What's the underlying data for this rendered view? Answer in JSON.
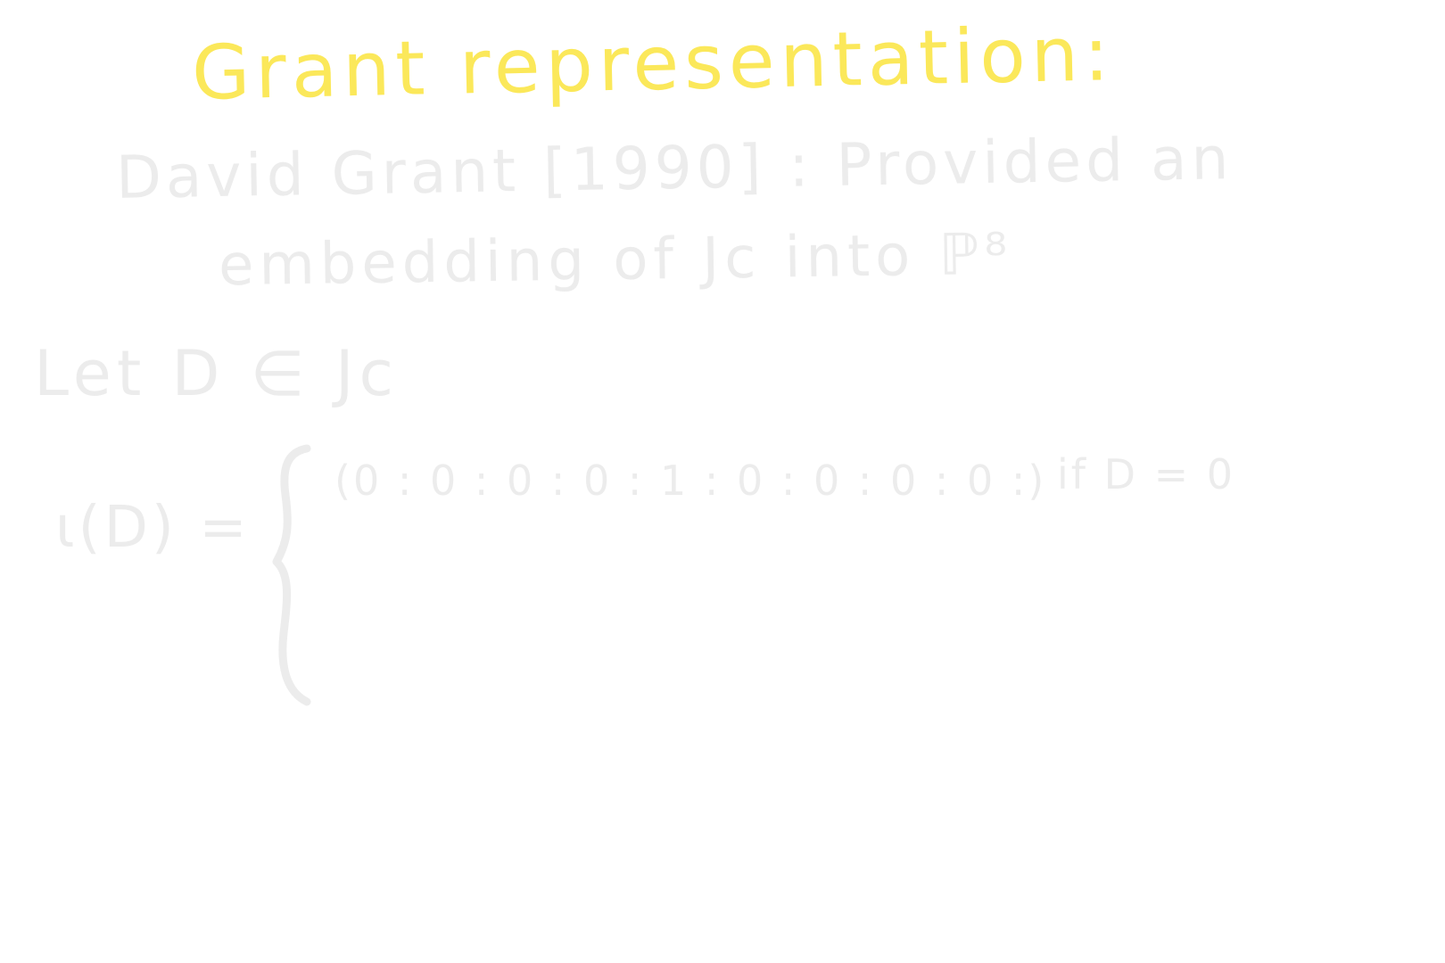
{
  "slide": {
    "title": "Grant representation:",
    "line1": "David Grant [1990] : Provided an",
    "line2": "embedding of Jc into ℙ⁸",
    "line3": "Let  D ∈ Jc",
    "lhs": "ι(D) =",
    "case1_value": "(0 : 0 : 0 : 0 : 1 : 0 : 0 : 0 : 0 :)",
    "case1_condition": "if D = 0"
  },
  "colors": {
    "background": "#ffffff",
    "title": "#fbe85a",
    "faint_text": "#ececec"
  }
}
